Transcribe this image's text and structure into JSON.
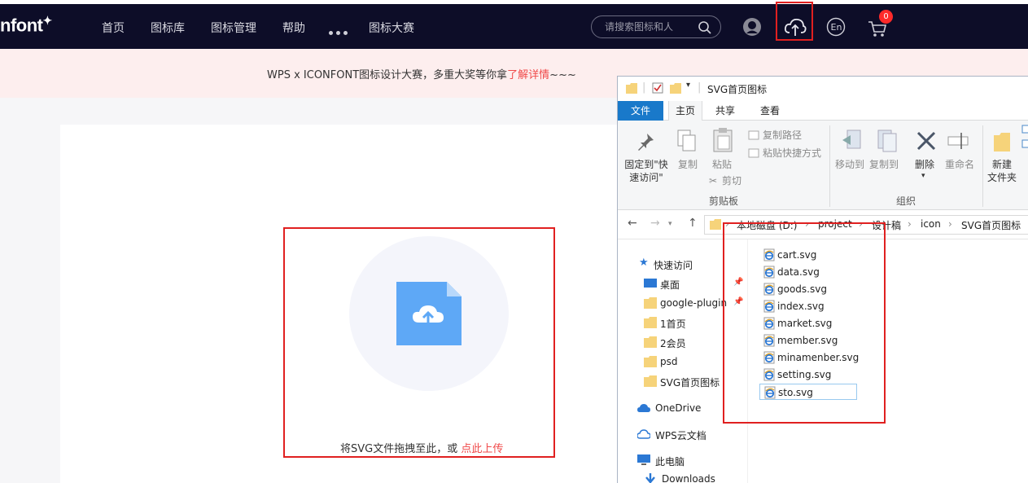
{
  "nav": {
    "logo": "nfont",
    "items": [
      "首页",
      "图标库",
      "图标管理",
      "帮助",
      "图标大赛"
    ],
    "search_placeholder": "请搜索图标和人",
    "cart_count": "0"
  },
  "banner": {
    "text": "WPS x ICONFONT图标设计大赛，多重大奖等你拿",
    "link": "了解详情",
    "suffix": "~~~"
  },
  "upload": {
    "text": "将SVG文件拖拽至此，或 ",
    "link": "点此上传"
  },
  "explorer": {
    "title": "SVG首页图标",
    "tabs": [
      "文件",
      "主页",
      "共享",
      "查看"
    ],
    "ribbon": {
      "pin_line1": "固定到\"快",
      "pin_line2": "速访问\"",
      "copy": "复制",
      "paste": "粘贴",
      "copy_path": "复制路径",
      "paste_shortcut": "粘贴快捷方式",
      "cut": "剪切",
      "clipboard_group": "剪贴板",
      "move_to": "移动到",
      "copy_to": "复制到",
      "delete": "删除",
      "rename": "重命名",
      "organize_group": "组织",
      "new_folder_line1": "新建",
      "new_folder_line2": "文件夹"
    },
    "breadcrumb": [
      "本地磁盘 (D:)",
      "project",
      "设计稿",
      "icon",
      "SVG首页图标"
    ],
    "nav_pane": [
      {
        "label": "快速访问",
        "icon": "star-icon"
      },
      {
        "label": "桌面",
        "icon": "desktop-icon"
      },
      {
        "label": "google-plugin",
        "icon": "folder-icon"
      },
      {
        "label": "1首页",
        "icon": "folder-icon"
      },
      {
        "label": "2会员",
        "icon": "folder-icon"
      },
      {
        "label": "psd",
        "icon": "folder-icon"
      },
      {
        "label": "SVG首页图标",
        "icon": "folder-icon"
      },
      {
        "label": "OneDrive",
        "icon": "cloud-icon"
      },
      {
        "label": "WPS云文档",
        "icon": "cloud-outline-icon"
      },
      {
        "label": "此电脑",
        "icon": "computer-icon"
      },
      {
        "label": "Downloads",
        "icon": "download-icon"
      }
    ],
    "files": [
      "cart.svg",
      "data.svg",
      "goods.svg",
      "index.svg",
      "market.svg",
      "member.svg",
      "minamenber.svg",
      "setting.svg",
      "sto.svg"
    ],
    "selected_file": "sto.svg"
  },
  "colors": {
    "nav_bg": "#0d0d28",
    "banner_bg": "#fdeeee",
    "highlight": "#e02020",
    "link": "#f04a4a",
    "file_tab": "#1979ca",
    "upload_blue": "#5ea8f6"
  }
}
